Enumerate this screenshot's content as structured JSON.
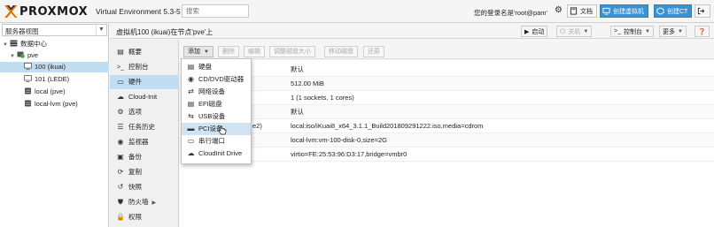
{
  "header": {
    "brand": "PROXMOX",
    "subtitle": "Virtual Environment 5.3-5",
    "search_placeholder": "搜索",
    "login_text": "您的登录名是'root@pam'",
    "buttons": {
      "docs": "文档",
      "create_vm": "创建虚拟机",
      "create_ct": "创建CT",
      "logout": "注销"
    }
  },
  "tree": {
    "view_selector": "服务器视图",
    "items": [
      {
        "label": "数据中心",
        "icon": "datacenter-icon"
      },
      {
        "label": "pve",
        "icon": "node-icon"
      },
      {
        "label": "100 (ikuai)",
        "icon": "vm-icon"
      },
      {
        "label": "101 (LEDE)",
        "icon": "vm-icon"
      },
      {
        "label": "local (pve)",
        "icon": "storage-icon"
      },
      {
        "label": "local-lvm (pve)",
        "icon": "storage-icon"
      }
    ]
  },
  "vm_header": {
    "title": "虚拟机100 (ikuai)在节点'pve'上",
    "start": "启动",
    "shutdown": "关机",
    "console": "控制台",
    "more": "更多"
  },
  "side_menu": [
    {
      "label": "概要",
      "icon": "summary-icon"
    },
    {
      "label": "控制台",
      "icon": "console-icon"
    },
    {
      "label": "硬件",
      "icon": "hardware-icon"
    },
    {
      "label": "Cloud-Init",
      "icon": "cloud-icon"
    },
    {
      "label": "选项",
      "icon": "options-icon"
    },
    {
      "label": "任务历史",
      "icon": "task-history-icon"
    },
    {
      "label": "监视器",
      "icon": "monitor-icon"
    },
    {
      "label": "备份",
      "icon": "backup-icon"
    },
    {
      "label": "复制",
      "icon": "replicate-icon"
    },
    {
      "label": "快照",
      "icon": "snapshot-icon"
    },
    {
      "label": "防火墙",
      "icon": "firewall-icon"
    },
    {
      "label": "权限",
      "icon": "permissions-icon"
    }
  ],
  "toolbar": {
    "add": "添加",
    "remove": "删除",
    "edit": "编辑",
    "resize_disk": "调整磁盘大小",
    "move_disk": "移动磁盘",
    "revert": "还原"
  },
  "hardware_rows": [
    {
      "key": "",
      "value": "默认"
    },
    {
      "key": "",
      "value": "512.00 MiB"
    },
    {
      "key": "",
      "value": "1 (1 sockets, 1 cores)"
    },
    {
      "key": "",
      "value": "默认"
    },
    {
      "key": "e2)",
      "value": "local:iso/iKuai8_x64_3.1.1_Build201809291222.iso,media=cdrom"
    },
    {
      "key": "",
      "value": "local-lvm:vm-100-disk-0,size=2G"
    },
    {
      "key": "",
      "value": "virtio=FE:25:53:96:D3:17,bridge=vmbr0"
    }
  ],
  "add_menu": [
    {
      "label": "硬盘",
      "icon": "harddisk-icon"
    },
    {
      "label": "CD/DVD驱动器",
      "icon": "cdrom-icon"
    },
    {
      "label": "网络设备",
      "icon": "network-icon"
    },
    {
      "label": "EFI磁盘",
      "icon": "efi-disk-icon"
    },
    {
      "label": "USB设备",
      "icon": "usb-icon"
    },
    {
      "label": "PCI设备",
      "icon": "pci-icon"
    },
    {
      "label": "串行端口",
      "icon": "serial-port-icon"
    },
    {
      "label": "CloudInit Drive",
      "icon": "cloudinit-drive-icon"
    }
  ]
}
